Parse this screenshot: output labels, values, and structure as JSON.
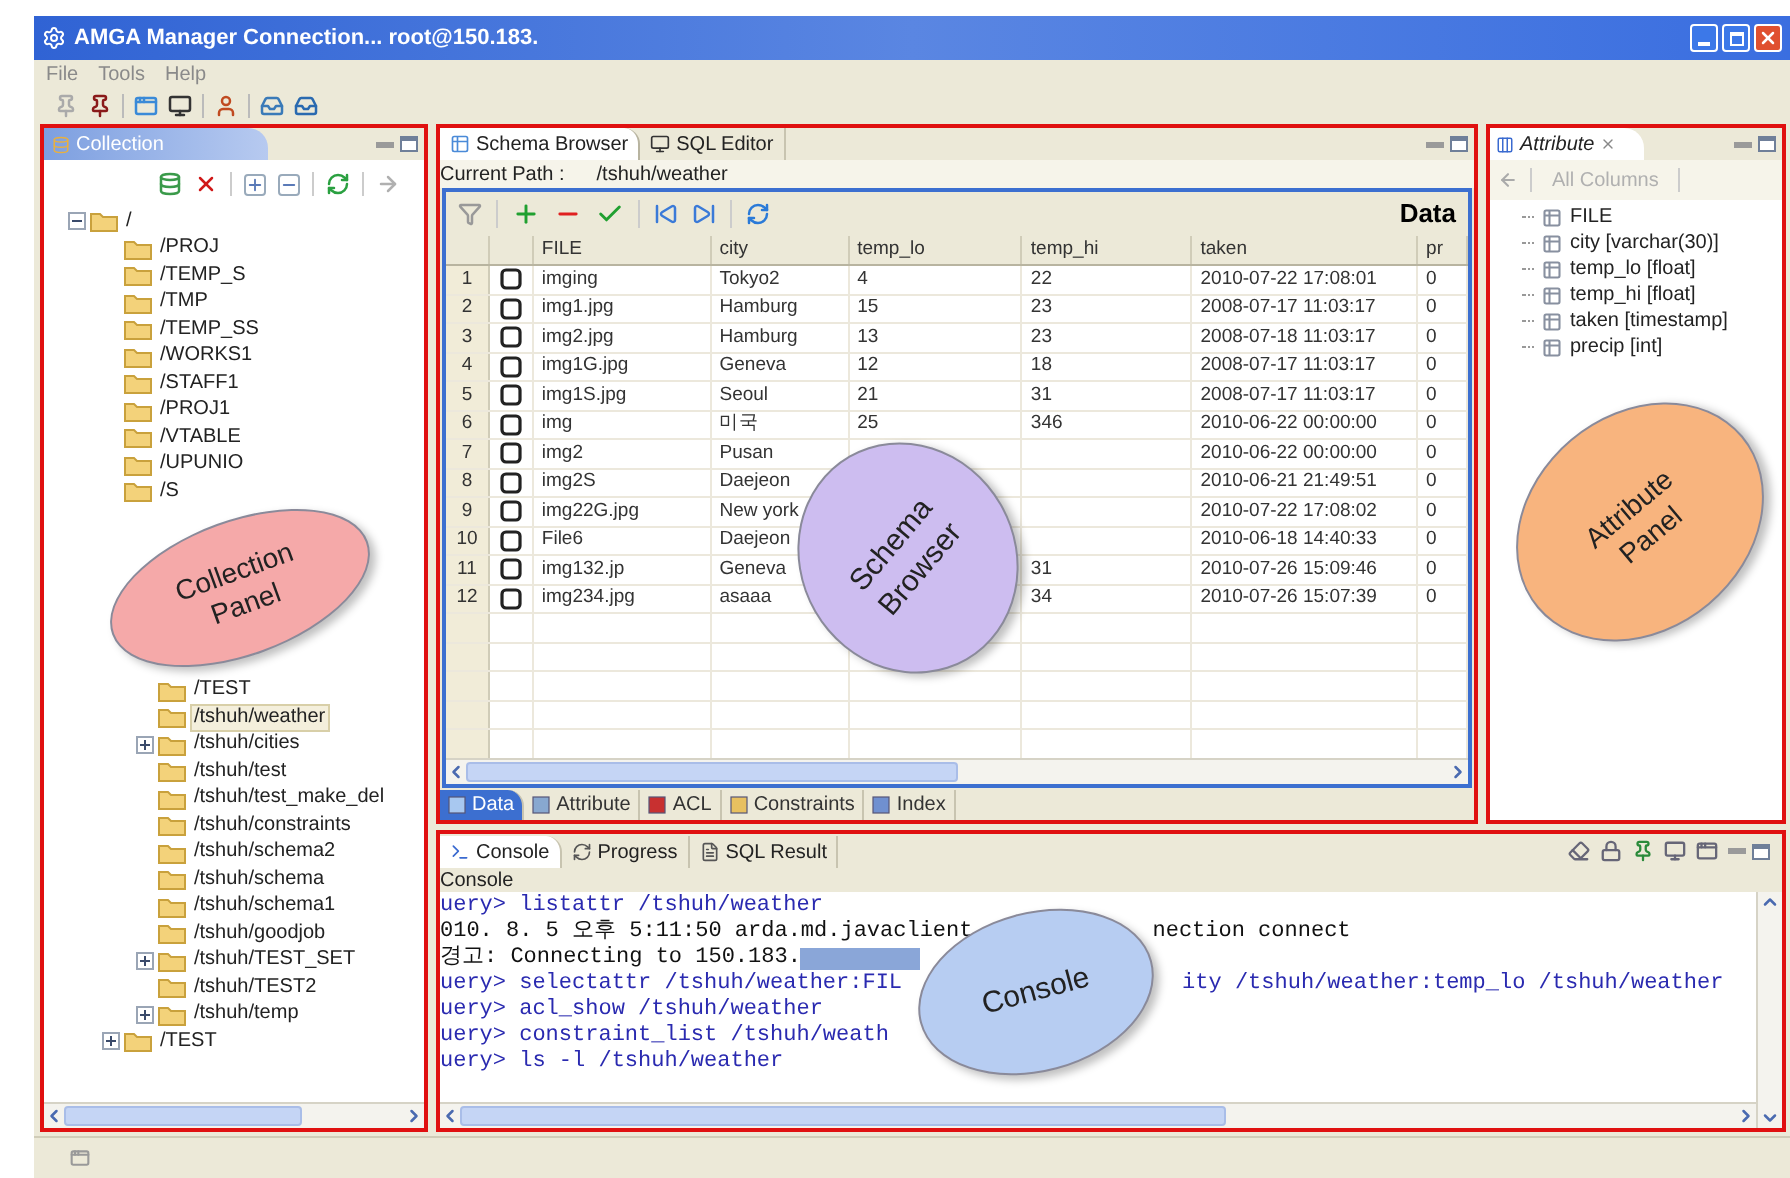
{
  "window": {
    "title": "AMGA Manager Connection... root@150.183."
  },
  "menu": [
    "File",
    "Tools",
    "Help"
  ],
  "collection_panel": {
    "tab": "Collection",
    "tree": {
      "label": "/",
      "expanded": true,
      "selected": false,
      "children": [
        {
          "label": "/PROJ",
          "selected": false
        },
        {
          "label": "/TEMP_S",
          "selected": false
        },
        {
          "label": "/TMP",
          "selected": false
        },
        {
          "label": "/TEMP_SS",
          "selected": false
        },
        {
          "label": "/WORKS1",
          "selected": false
        },
        {
          "label": "/STAFF1",
          "selected": false
        },
        {
          "label": "/PROJ1",
          "selected": false
        },
        {
          "label": "/VTABLE",
          "selected": false
        },
        {
          "label": "/UPUNIO",
          "selected": false
        },
        {
          "label": "/S",
          "selected": false
        },
        {
          "expanded": true,
          "children": [
            {
              "label": "/TEST",
              "selected": false
            },
            {
              "label": "/tshuh/weather",
              "selected": true
            },
            {
              "label": "/tshuh/cities",
              "expanded": false,
              "selected": false
            },
            {
              "label": "/tshuh/test",
              "selected": false
            },
            {
              "label": "/tshuh/test_make_del",
              "selected": false
            },
            {
              "label": "/tshuh/constraints",
              "selected": false
            },
            {
              "label": "/tshuh/schema2",
              "selected": false
            },
            {
              "label": "/tshuh/schema",
              "selected": false
            },
            {
              "label": "/tshuh/schema1",
              "selected": false
            },
            {
              "label": "/tshuh/goodjob",
              "selected": false
            },
            {
              "label": "/tshuh/TEST_SET",
              "expanded": false,
              "selected": false
            },
            {
              "label": "/tshuh/TEST2",
              "selected": false
            },
            {
              "label": "/tshuh/temp",
              "expanded": false,
              "selected": false
            }
          ]
        },
        {
          "label": "/TEST",
          "expanded": false,
          "selected": false
        }
      ]
    },
    "callout": {
      "lines": [
        "Collection",
        "Panel"
      ],
      "color": "#f5a9a9"
    }
  },
  "schema_browser": {
    "tabs": [
      {
        "label": "Schema Browser",
        "selected": true
      },
      {
        "label": "SQL Editor",
        "selected": false
      }
    ],
    "path_label": "Current Path :",
    "path": "/tshuh/weather",
    "view_title": "Data",
    "table": {
      "columns": [
        "FILE",
        "city",
        "temp_lo",
        "temp_hi",
        "taken",
        "pr"
      ],
      "rows": [
        {
          "num": "1",
          "checked": false,
          "cells": [
            "imging",
            "Tokyo2",
            "4",
            "22",
            "2010-07-22 17:08:01",
            "0"
          ]
        },
        {
          "num": "2",
          "checked": false,
          "cells": [
            "img1.jpg",
            "Hamburg",
            "15",
            "23",
            "2008-07-17 11:03:17",
            "0"
          ]
        },
        {
          "num": "3",
          "checked": false,
          "cells": [
            "img2.jpg",
            "Hamburg",
            "13",
            "23",
            "2008-07-18 11:03:17",
            "0"
          ]
        },
        {
          "num": "4",
          "checked": false,
          "cells": [
            "img1G.jpg",
            "Geneva",
            "12",
            "18",
            "2008-07-17 11:03:17",
            "0"
          ]
        },
        {
          "num": "5",
          "checked": false,
          "cells": [
            "img1S.jpg",
            "Seoul",
            "21",
            "31",
            "2008-07-17 11:03:17",
            "0"
          ]
        },
        {
          "num": "6",
          "checked": false,
          "cells": [
            "img",
            "미국",
            "25",
            "346",
            "2010-06-22 00:00:00",
            "0"
          ]
        },
        {
          "num": "7",
          "checked": false,
          "cells": [
            "img2",
            "Pusan",
            null,
            null,
            "2010-06-22 00:00:00",
            "0"
          ]
        },
        {
          "num": "8",
          "checked": false,
          "cells": [
            "img2S",
            "Daejeon",
            null,
            null,
            "2010-06-21 21:49:51",
            "0"
          ]
        },
        {
          "num": "9",
          "checked": false,
          "cells": [
            "img22G.jpg",
            "New york",
            null,
            null,
            "2010-07-22 17:08:02",
            "0"
          ]
        },
        {
          "num": "10",
          "checked": false,
          "cells": [
            "File6",
            "Daejeon",
            null,
            null,
            "2010-06-18 14:40:33",
            "0"
          ]
        },
        {
          "num": "11",
          "checked": false,
          "cells": [
            "img132.jp",
            "Geneva",
            null,
            "31",
            "2010-07-26 15:09:46",
            "0"
          ]
        },
        {
          "num": "12",
          "checked": false,
          "cells": [
            "img234.jpg",
            "asaaa",
            null,
            "34",
            "2010-07-26 15:07:39",
            "0"
          ]
        }
      ]
    },
    "bottom_tabs": [
      {
        "label": "Data",
        "selected": true
      },
      {
        "label": "Attribute",
        "selected": false
      },
      {
        "label": "ACL",
        "selected": false
      },
      {
        "label": "Constraints",
        "selected": false
      },
      {
        "label": "Index",
        "selected": false
      }
    ],
    "callout": {
      "lines": [
        "Schema",
        "Browser"
      ],
      "color": "#cdbdf0"
    }
  },
  "attribute_panel": {
    "tab": "Attribute",
    "filter": "All Columns",
    "items": [
      "FILE",
      "city [varchar(30)]",
      "temp_lo [float]",
      "temp_hi [float]",
      "taken [timestamp]",
      "precip [int]"
    ],
    "callout": {
      "lines": [
        "Attribute",
        "Panel"
      ],
      "color": "#f8b47e"
    }
  },
  "console_panel": {
    "tabs": [
      {
        "label": "Console",
        "selected": true
      },
      {
        "label": "Progress",
        "selected": false
      },
      {
        "label": "SQL Result",
        "selected": false
      }
    ],
    "title": "Console",
    "lines": [
      {
        "kind": "query",
        "segments": [
          "uery> listattr /tshuh/weather"
        ]
      },
      {
        "kind": "info",
        "segments": [
          "010. 8. 5 오후 5:11:50 arda.md.javaclient",
          "nection connect"
        ]
      },
      {
        "kind": "info",
        "segments": [
          "경고: Connecting to 150.183."
        ],
        "redacted": true
      },
      {
        "kind": "query",
        "segments": [
          "uery> selectattr /tshuh/weather:FIL",
          "ity /tshuh/weather:temp_lo /tshuh/weather"
        ]
      },
      {
        "kind": "query",
        "segments": [
          "uery> acl_show /tshuh/weather"
        ]
      },
      {
        "kind": "query",
        "segments": [
          "uery> constraint_list /tshuh/weath"
        ]
      },
      {
        "kind": "query",
        "segments": [
          "uery> ls -l /tshuh/weather"
        ]
      }
    ],
    "callout": {
      "lines": [
        "Console"
      ],
      "color": "#b7cdf2"
    }
  }
}
